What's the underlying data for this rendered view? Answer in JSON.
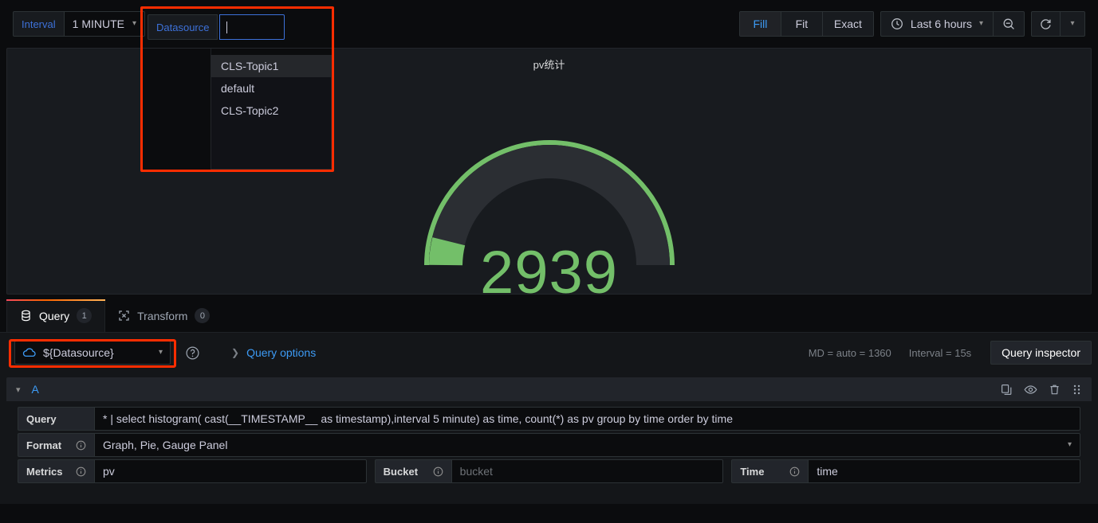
{
  "topbar": {
    "interval_label": "Interval",
    "interval_value": "1 MINUTE",
    "datasource_label": "Datasource",
    "datasource_value": "",
    "datasource_placeholder": "",
    "datasource_options": [
      "CLS-Topic1",
      "default",
      "CLS-Topic2"
    ],
    "fit_buttons": [
      {
        "label": "Fill",
        "active": true
      },
      {
        "label": "Fit",
        "active": false
      },
      {
        "label": "Exact",
        "active": false
      }
    ],
    "time_range": "Last 6 hours",
    "icons": {
      "clock": "clock-icon",
      "zoom_out": "zoom-out-icon",
      "refresh": "refresh-icon",
      "chevron": "chevron-down-icon"
    }
  },
  "panel": {
    "title": "pv统计",
    "gauge_value": "2939",
    "gauge_color": "#73bf69",
    "track_color": "#2b2e33"
  },
  "chart_data": {
    "type": "gauge",
    "title": "pv统计",
    "value": 2939,
    "min": 0,
    "max": 32000,
    "fill_fraction": 0.09,
    "threshold_color": "#73bf69",
    "unit": "",
    "series": [
      {
        "name": "pv",
        "values": [
          2939
        ]
      }
    ]
  },
  "tabs": [
    {
      "label": "Query",
      "count": "1",
      "icon": "database-icon",
      "active": true
    },
    {
      "label": "Transform",
      "count": "0",
      "icon": "transform-icon",
      "active": false
    }
  ],
  "query_editor": {
    "datasource_picker": "${Datasource}",
    "datasource_icon": "cloud-icon",
    "help_icon": "help-circle-icon",
    "query_options_label": "Query options",
    "max_data_points": "MD = auto = 1360",
    "interval_info": "Interval = 15s",
    "query_inspector_label": "Query inspector",
    "row": {
      "name": "A",
      "actions": [
        "copy-icon",
        "eye-icon",
        "trash-icon",
        "drag-handle-icon"
      ]
    },
    "fields": {
      "query_label": "Query",
      "query_value": "* | select histogram( cast(__TIMESTAMP__ as timestamp),interval 5 minute) as time, count(*) as pv group by time order by time",
      "format_label": "Format",
      "format_value": "Graph, Pie, Gauge Panel",
      "metrics_label": "Metrics",
      "metrics_value": "pv",
      "bucket_label": "Bucket",
      "bucket_value": "",
      "bucket_placeholder": "bucket",
      "time_label": "Time",
      "time_value": "time"
    }
  }
}
